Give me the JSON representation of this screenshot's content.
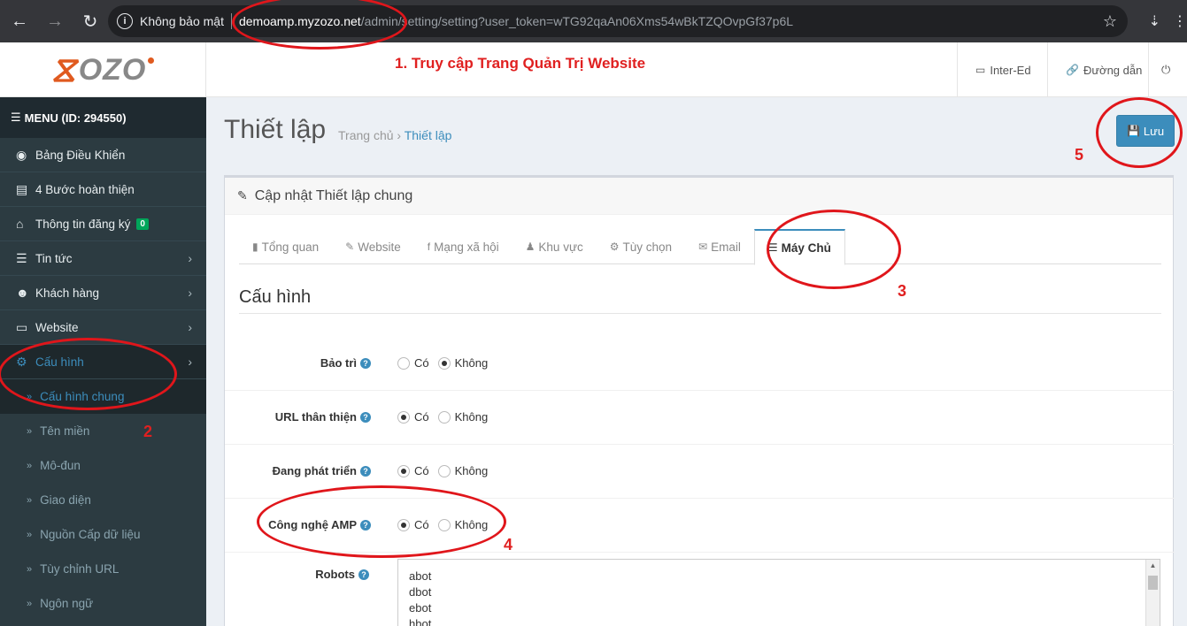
{
  "browser": {
    "security_label": "Không bảo mật",
    "url_host": "demoamp.myzozo.net",
    "url_path": "/admin/setting/setting?user_token=wTG92qaAn06Xms54wBkTZQOvpGf37p6L"
  },
  "header": {
    "logo_text": "OZO",
    "step1_label": "1. Truy cập Trang Quản Trị Website",
    "links": [
      {
        "label": "Inter-Ed"
      },
      {
        "label": "Đường dẫn"
      }
    ]
  },
  "sidebar": {
    "menu_title": "MENU (ID: 294550)",
    "items": [
      {
        "label": "Bảng Điều Khiển"
      },
      {
        "label": "4 Bước hoàn thiện"
      },
      {
        "label": "Thông tin đăng ký",
        "badge": "0"
      },
      {
        "label": "Tin tức"
      },
      {
        "label": "Khách hàng"
      },
      {
        "label": "Website"
      },
      {
        "label": "Cấu hình"
      }
    ],
    "sub_items": [
      {
        "label": "Cấu hình chung"
      },
      {
        "label": "Tên miền"
      },
      {
        "label": "Mô-đun"
      },
      {
        "label": "Giao diện"
      },
      {
        "label": "Nguồn Cấp dữ liệu"
      },
      {
        "label": "Tùy chỉnh URL"
      },
      {
        "label": "Ngôn ngữ"
      }
    ]
  },
  "page": {
    "title": "Thiết lập",
    "breadcrumb_home": "Trang chủ",
    "breadcrumb_sep": "›",
    "breadcrumb_current": "Thiết lập",
    "save_label": "Lưu",
    "box_title": "Cập nhật Thiết lập chung",
    "tabs": [
      {
        "label": "Tổng quan"
      },
      {
        "label": "Website"
      },
      {
        "label": "Mạng xã hội"
      },
      {
        "label": "Khu vực"
      },
      {
        "label": "Tùy chọn"
      },
      {
        "label": "Email"
      },
      {
        "label": "Máy Chủ"
      }
    ],
    "section_title": "Cấu hình",
    "yes_label": "Có",
    "no_label": "Không",
    "fields": [
      {
        "label": "Bảo trì",
        "selected": "no"
      },
      {
        "label": "URL thân thiện",
        "selected": "yes"
      },
      {
        "label": "Đang phát triển",
        "selected": "yes"
      },
      {
        "label": "Công nghệ AMP",
        "selected": "yes"
      }
    ],
    "robots_label": "Robots",
    "robots_lines": [
      "abot",
      "dbot",
      "ebot",
      "hbot"
    ]
  },
  "steps": {
    "s2": "2",
    "s3": "3",
    "s4": "4",
    "s5": "5"
  },
  "colors": {
    "accent": "#3c8dbc",
    "sidebar_bg": "#2c3b41",
    "annotation": "#e0161b",
    "badge": "#00a65a"
  }
}
